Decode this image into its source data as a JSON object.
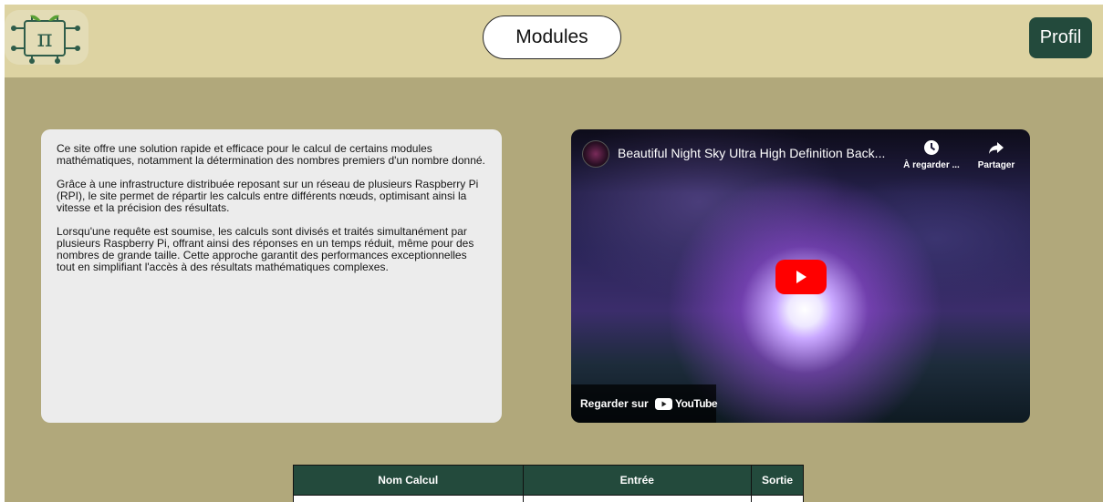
{
  "header": {
    "modules_label": "Modules",
    "profil_label": "Profil"
  },
  "intro": {
    "paragraphs": [
      "Ce site offre une solution rapide et efficace pour le calcul de certains modules mathématiques, notamment la détermination des nombres premiers d'un nombre donné.",
      "Grâce à une infrastructure distribuée reposant sur un réseau de plusieurs Raspberry Pi (RPI), le site permet de répartir les calculs entre différents nœuds, optimisant ainsi la vitesse et la précision des résultats.",
      "Lorsqu'une requête est soumise, les calculs sont divisés et traités simultanément par plusieurs Raspberry Pi, offrant ainsi des réponses en un temps réduit, même pour des nombres de grande taille. Cette approche garantit des performances exceptionnelles tout en simplifiant l'accès à des résultats mathématiques complexes."
    ]
  },
  "video": {
    "title": "Beautiful Night Sky Ultra High Definition Back...",
    "watch_later_label": "À regarder ...",
    "share_label": "Partager",
    "watch_on_label": "Regarder sur",
    "youtube_label": "YouTube"
  },
  "table": {
    "columns": [
      "Nom Calcul",
      "Entrée",
      "Sortie"
    ]
  },
  "colors": {
    "page_background": "#b1a87b",
    "header_background": "#ddd3a2",
    "accent_green": "#234a3c",
    "youtube_red": "#ff0000"
  },
  "icons": {
    "logo": "raspberry-pi-logo",
    "watch_later": "clock-icon",
    "share": "share-arrow-icon",
    "play": "play-icon",
    "youtube": "youtube-logo-icon"
  }
}
